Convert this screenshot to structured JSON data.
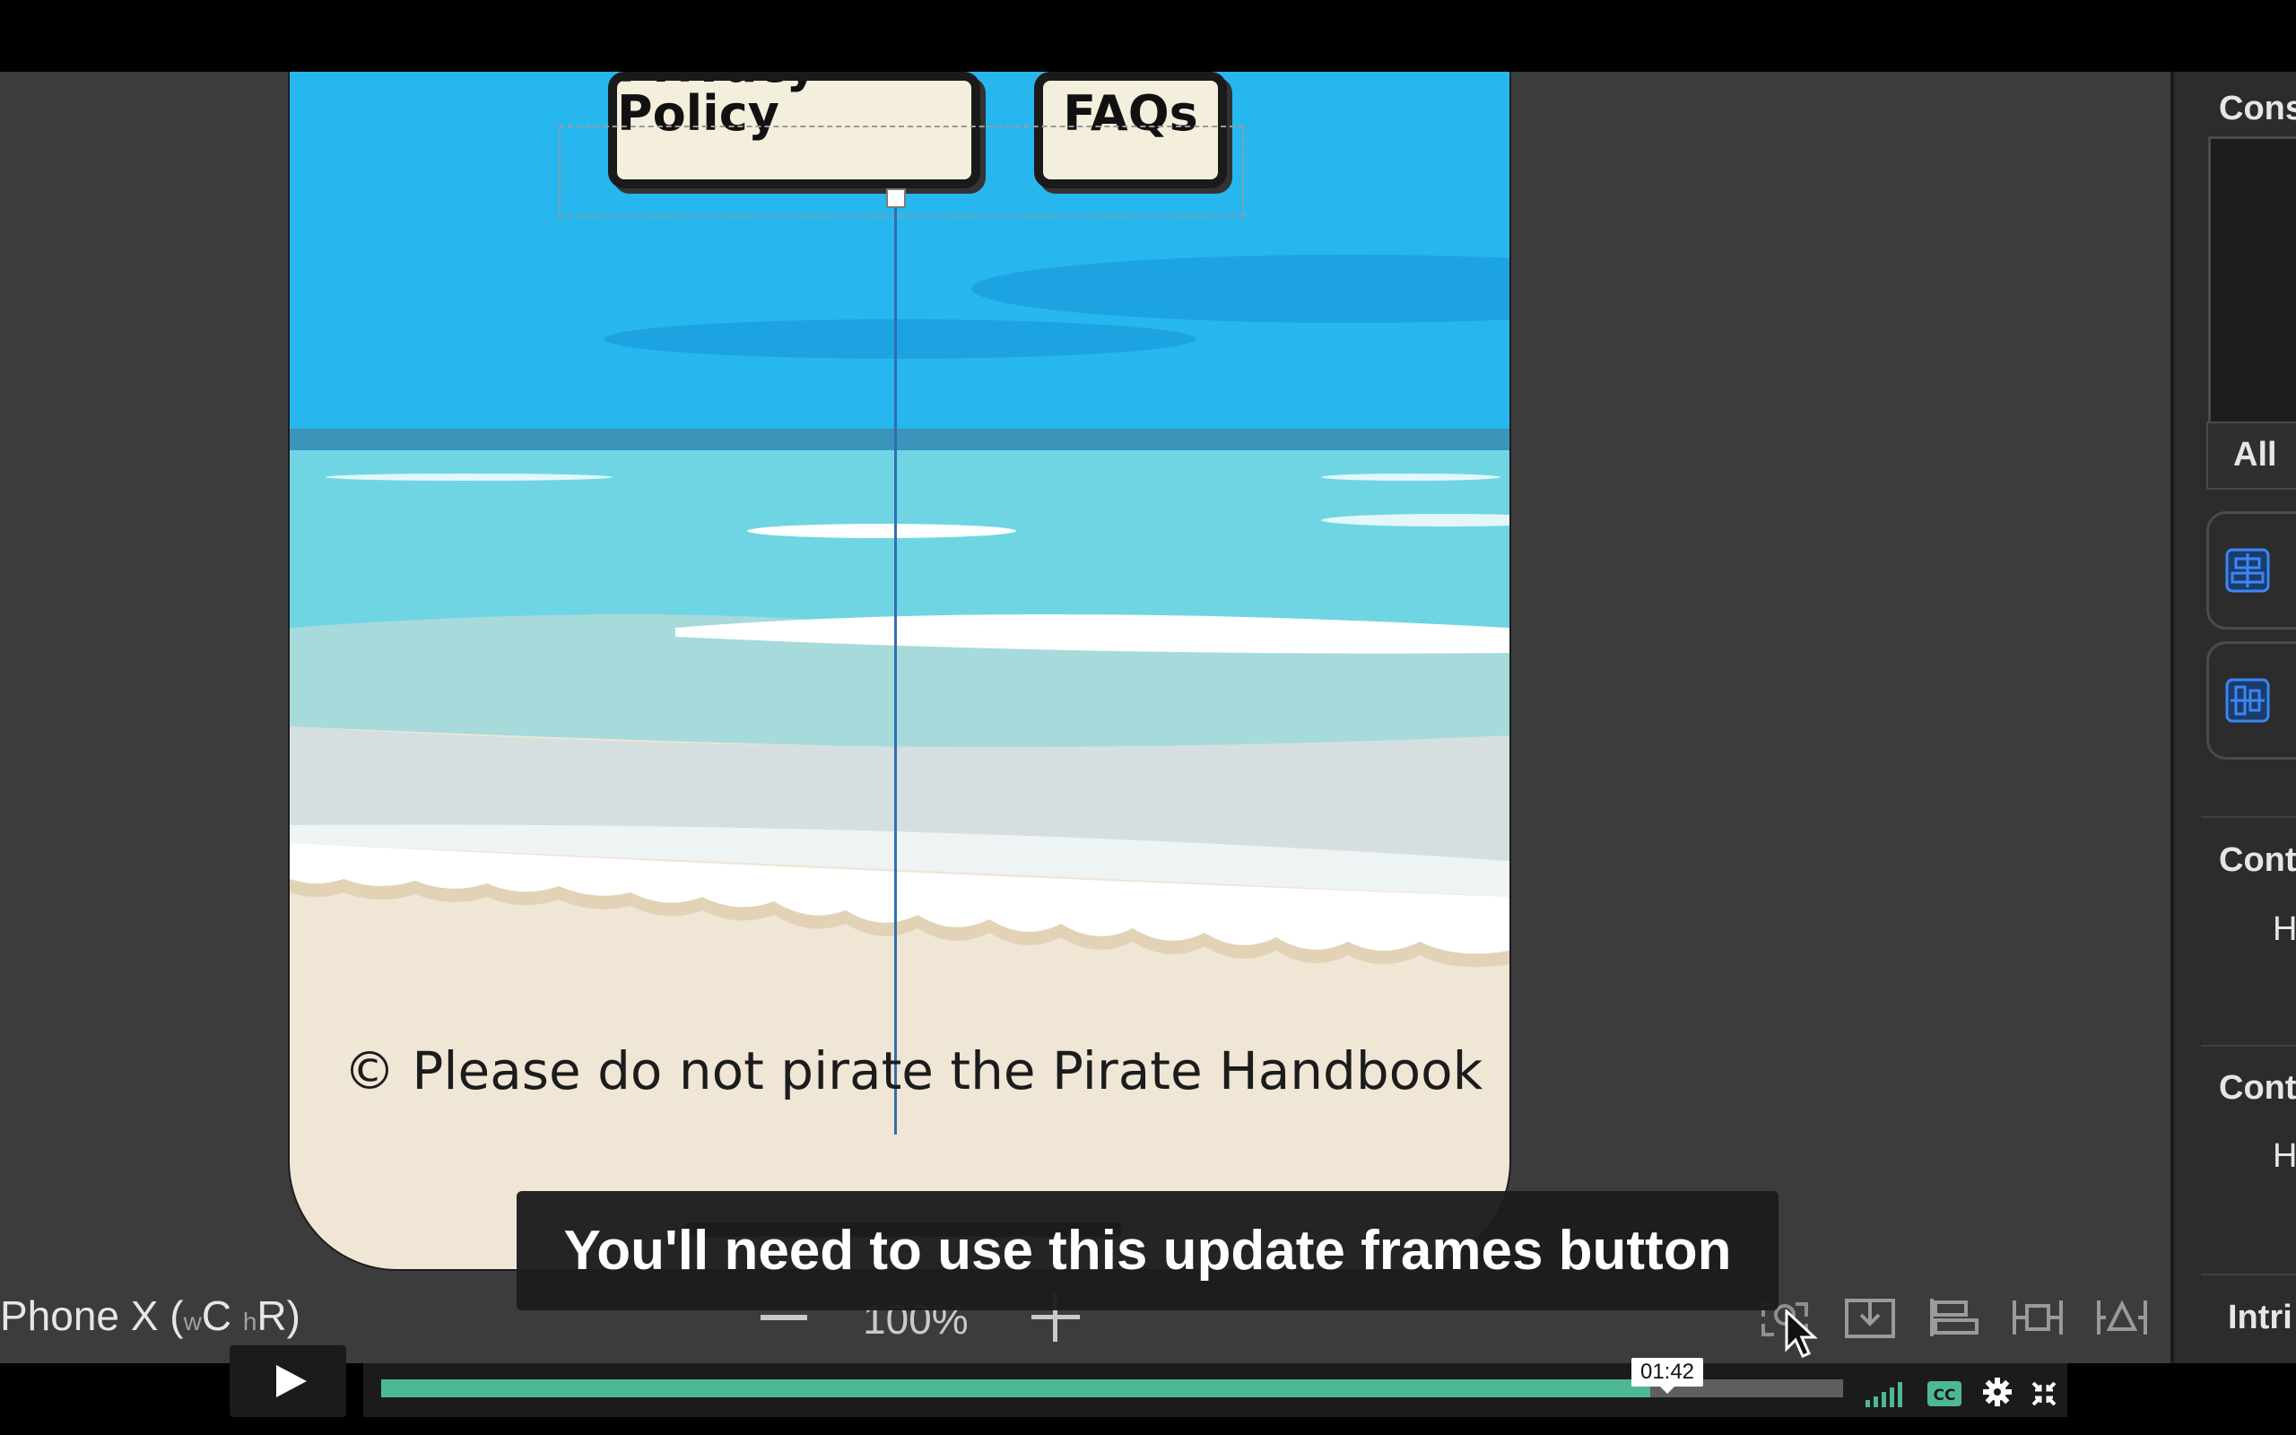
{
  "phone_screen": {
    "buttons": [
      {
        "label": "Privacy Policy"
      },
      {
        "label": "FAQs"
      }
    ],
    "copyright": "© Please do not pirate the Pirate Handbook"
  },
  "canvas_toolbar": {
    "device_name": "Phone X (",
    "size_class_w": "w",
    "size_class_w_val": "C",
    "size_class_h": "h",
    "size_class_h_val": "R)",
    "zoom_level": "100%",
    "icons": [
      "update-frames-icon",
      "embed-in-icon",
      "align-icon",
      "add-constraints-icon",
      "resolve-issues-icon"
    ]
  },
  "inspector": {
    "constraints_heading": "Cons",
    "all_label": "All",
    "content_hugging_heading": "Cont",
    "content_hugging_h": "H",
    "compression_heading": "Cont",
    "compression_h": "H",
    "intrinsic_label": "Intri"
  },
  "subtitle": "You'll need to use this update frames button",
  "player": {
    "time_tooltip": "01:42",
    "progress_fraction": 0.868,
    "accent_color": "#4eb896"
  }
}
